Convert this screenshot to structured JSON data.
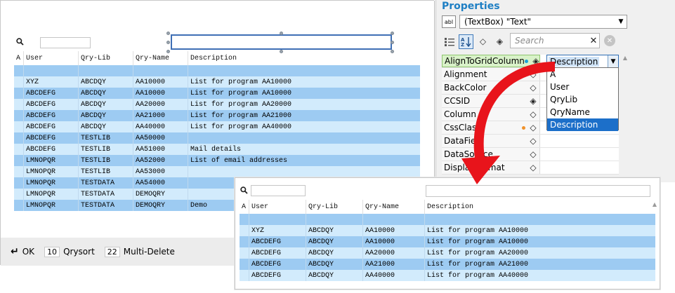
{
  "designer": {
    "search_value": "",
    "columns": [
      "A",
      "User",
      "Qry-Lib",
      "Qry-Name",
      "Description"
    ],
    "rows": [
      {
        "style": "dark",
        "cells": [
          "",
          "",
          "",
          "",
          ""
        ]
      },
      {
        "style": "light",
        "cells": [
          "",
          "XYZ",
          "ABCDQY",
          "AA10000",
          "List for program AA10000"
        ]
      },
      {
        "style": "dark",
        "cells": [
          "",
          "ABCDEFG",
          "ABCDQY",
          "AA10000",
          "List for program AA10000"
        ]
      },
      {
        "style": "light",
        "cells": [
          "",
          "ABCDEFG",
          "ABCDQY",
          "AA20000",
          "List for program AA20000"
        ]
      },
      {
        "style": "dark",
        "cells": [
          "",
          "ABCDEFG",
          "ABCDQY",
          "AA21000",
          "List for program AA21000"
        ]
      },
      {
        "style": "light",
        "cells": [
          "",
          "ABCDEFG",
          "ABCDQY",
          "AA40000",
          "List for program AA40000"
        ]
      },
      {
        "style": "dark",
        "cells": [
          "",
          "ABCDEFG",
          "TESTLIB",
          "AA50000",
          ""
        ]
      },
      {
        "style": "light",
        "cells": [
          "",
          "ABCDEFG",
          "TESTLIB",
          "AA51000",
          "Mail details"
        ]
      },
      {
        "style": "dark",
        "cells": [
          "",
          "LMNOPQR",
          "TESTLIB",
          "AA52000",
          "List of email addresses"
        ]
      },
      {
        "style": "light",
        "cells": [
          "",
          "LMNOPQR",
          "TESTLIB",
          "AA53000",
          ""
        ]
      },
      {
        "style": "dark",
        "cells": [
          "",
          "LMNOPQR",
          "TESTDATA",
          "AA54000",
          ""
        ]
      },
      {
        "style": "light",
        "cells": [
          "",
          "LMNOPQR",
          "TESTDATA",
          "DEMOQRY",
          ""
        ]
      },
      {
        "style": "dark",
        "cells": [
          "",
          "LMNOPQR",
          "TESTDATA",
          "DEMOQRY",
          "Demo"
        ]
      }
    ],
    "status": {
      "ok_label": "OK",
      "qrysort_key": "10",
      "qrysort_label": "Qrysort",
      "multidelete_key": "22",
      "multidelete_label": "Multi-Delete"
    }
  },
  "properties": {
    "title": "Properties",
    "object_icon_text": "abl",
    "object_selector": "(TextBox) \"Text\"",
    "search_placeholder": "Search",
    "rows": [
      {
        "name": "AlignToGridColumn",
        "dot": "#1aa3d9",
        "marker": "◈"
      },
      {
        "name": "Alignment",
        "dot": "",
        "marker": "◇"
      },
      {
        "name": "BackColor",
        "dot": "",
        "marker": "◇"
      },
      {
        "name": "CCSID",
        "dot": "",
        "marker": "◈"
      },
      {
        "name": "Column",
        "dot": "",
        "marker": "◇"
      },
      {
        "name": "CssClass",
        "dot": "#f0922a",
        "marker": "◇"
      },
      {
        "name": "DataField",
        "dot": "",
        "marker": "◇"
      },
      {
        "name": "DataSource",
        "dot": "",
        "marker": "◇"
      },
      {
        "name": "DisplayFormat",
        "dot": "",
        "marker": "◇"
      }
    ],
    "align_value": "Description",
    "dropdown_options": [
      "A",
      "User",
      "QryLib",
      "QryName",
      "Description"
    ],
    "dropdown_selected": "Description"
  },
  "result": {
    "search_value": "",
    "columns": [
      "A",
      "User",
      "Qry-Lib",
      "Qry-Name",
      "Description"
    ],
    "rows": [
      {
        "style": "dark",
        "cells": [
          "",
          "",
          "",
          "",
          ""
        ]
      },
      {
        "style": "light",
        "cells": [
          "",
          "XYZ",
          "ABCDQY",
          "AA10000",
          "List for program AA10000"
        ]
      },
      {
        "style": "dark",
        "cells": [
          "",
          "ABCDEFG",
          "ABCDQY",
          "AA10000",
          "List for program AA10000"
        ]
      },
      {
        "style": "light",
        "cells": [
          "",
          "ABCDEFG",
          "ABCDQY",
          "AA20000",
          "List for program AA20000"
        ]
      },
      {
        "style": "dark",
        "cells": [
          "",
          "ABCDEFG",
          "ABCDQY",
          "AA21000",
          "List for program AA21000"
        ]
      },
      {
        "style": "light",
        "cells": [
          "",
          "ABCDEFG",
          "ABCDQY",
          "AA40000",
          "List for program AA40000"
        ]
      }
    ]
  },
  "colors": {
    "row_dark": "#9dcbf2",
    "row_light": "#d2ebfc",
    "accent": "#1e7fc4",
    "arrow": "#e8141b"
  }
}
